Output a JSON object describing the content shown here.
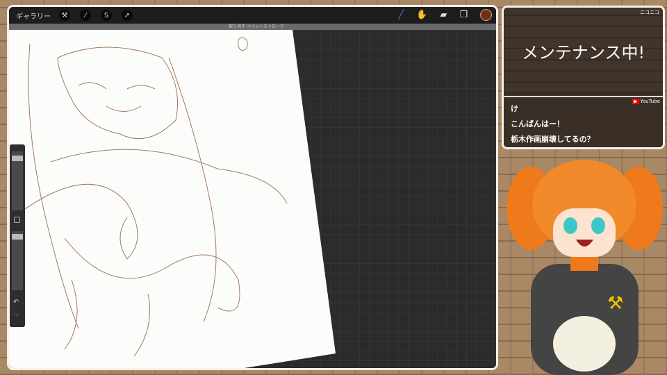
{
  "toolbar": {
    "gallery": "ギャラリー",
    "icons": [
      "wrench-icon",
      "magic-wand-icon",
      "selection-icon",
      "transform-arrow-icon"
    ],
    "undo_hint": "取り消す ペイントストローク",
    "brush_color": "#7a2e0e"
  },
  "stream": {
    "maintenance": "メンテナンス中!",
    "niconico_label": "ニコニコ",
    "youtube_label": "YouTube",
    "comments": [
      "け",
      "こんばんはー！",
      "栃木作画崩壊してるの？"
    ]
  }
}
